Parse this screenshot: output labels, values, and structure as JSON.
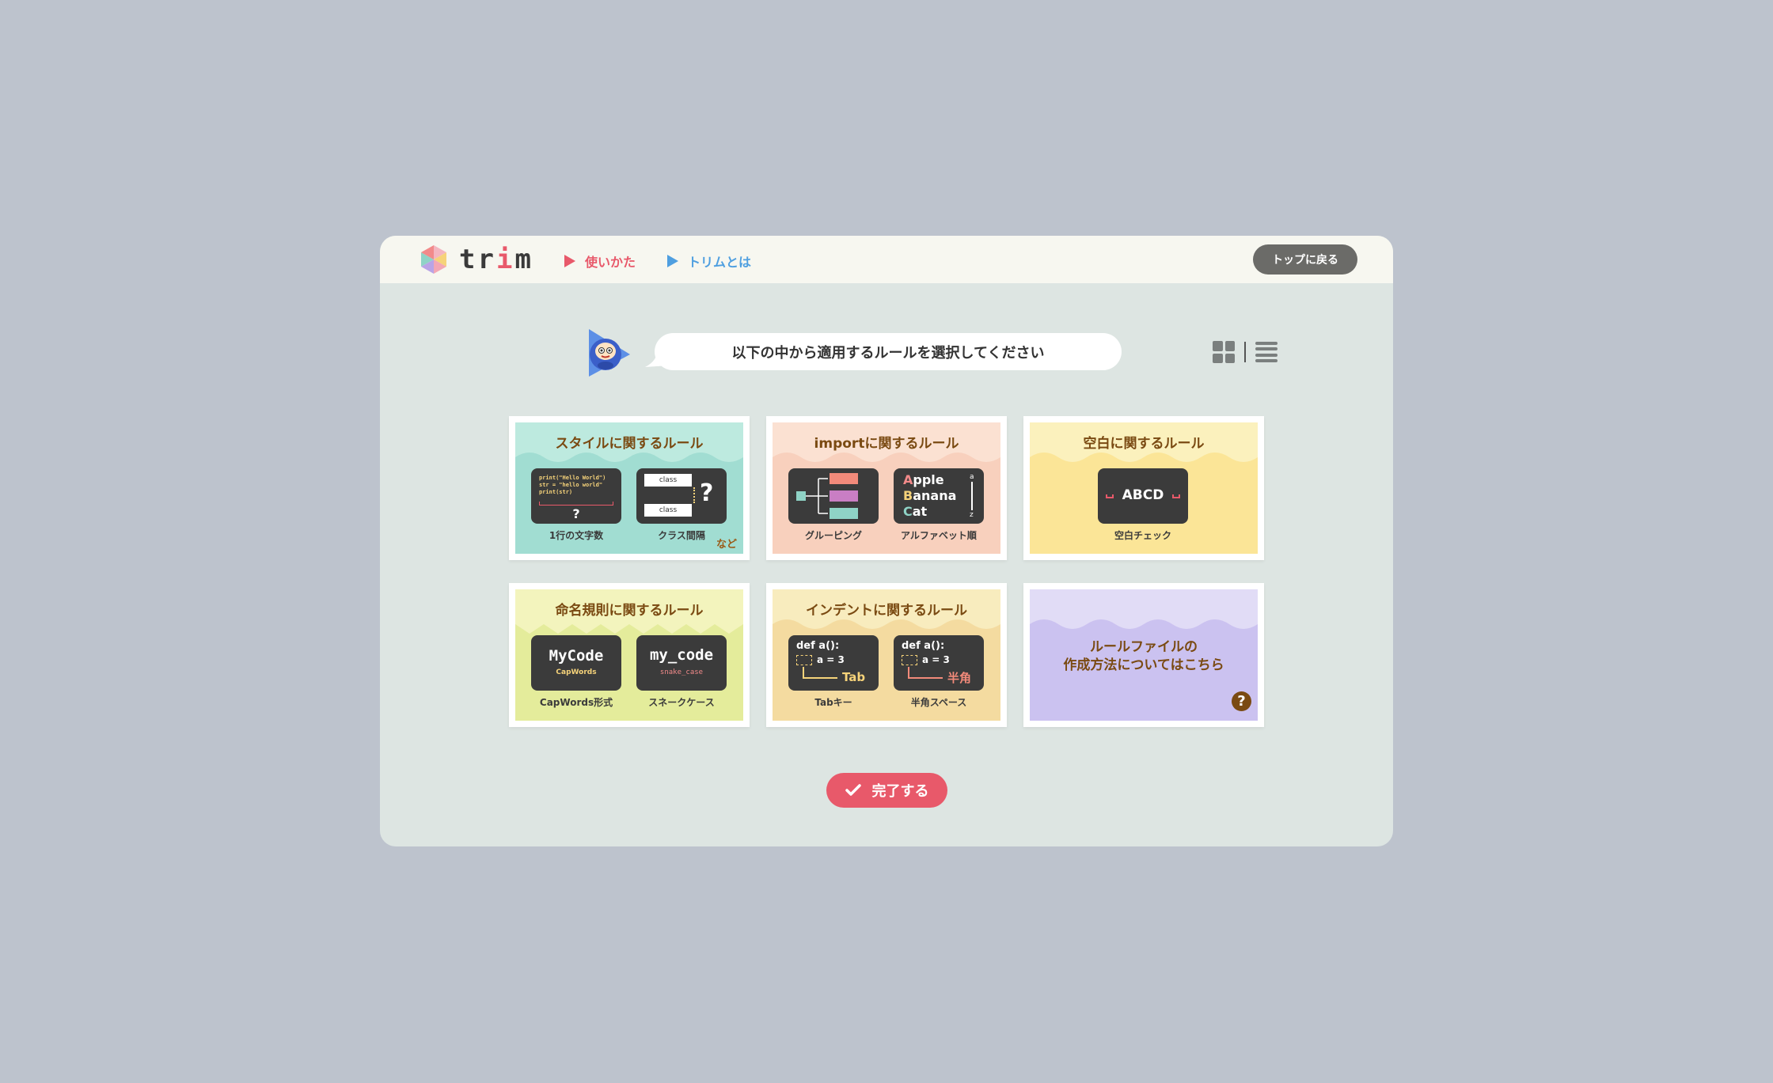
{
  "header": {
    "logo_text": "trim",
    "nav": [
      {
        "label": "使いかた",
        "color": "#e8596a"
      },
      {
        "label": "トリムとは",
        "color": "#4f9fe0"
      }
    ],
    "top_button": "トップに戻る"
  },
  "prompt": {
    "message": "以下の中から適用するルールを選択してください"
  },
  "cards": {
    "style": {
      "title": "スタイルに関するルール",
      "code_lines": [
        "print(\"Hello World\")",
        "str = \"hello world\"",
        "print(str)"
      ],
      "question": "?",
      "class_label": "class",
      "labels": [
        "1行の文字数",
        "クラス間隔"
      ],
      "more": "など",
      "colors": {
        "bg": "#a1ddd2",
        "wave": "#bdeadf"
      }
    },
    "import": {
      "title": "importに関するルール",
      "alpha": [
        {
          "first": "A",
          "rest": "pple"
        },
        {
          "first": "B",
          "rest": "anana"
        },
        {
          "first": "C",
          "rest": "at"
        }
      ],
      "range": [
        "a",
        "z"
      ],
      "labels": [
        "グルーピング",
        "アルファベット順"
      ],
      "colors": {
        "bg": "#f8d0bd",
        "wave": "#fbe1d2"
      }
    },
    "whitespace": {
      "title": "空白に関するルール",
      "sample": "ABCD",
      "labels": [
        "空白チェック"
      ],
      "colors": {
        "bg": "#fbe597",
        "wave": "#fbf1bd"
      }
    },
    "naming": {
      "title": "命名規則に関するルール",
      "items": [
        {
          "main": "MyCode",
          "sub": "CapWords"
        },
        {
          "main": "my_code",
          "sub": "snake_case"
        }
      ],
      "labels": [
        "CapWords形式",
        "スネークケース"
      ],
      "colors": {
        "bg": "#e4ec9b",
        "wave": "#f3f4bd"
      }
    },
    "indent": {
      "title": "インデントに関するルール",
      "code_head": "def a():",
      "code_body": "a = 3",
      "arrows": [
        "Tab",
        "半角"
      ],
      "labels": [
        "Tabキー",
        "半角スペース"
      ],
      "colors": {
        "bg": "#f4dba0",
        "wave": "#f8ecbe"
      }
    },
    "rulefile": {
      "title_line1": "ルールファイルの",
      "title_line2": "作成方法についてはこちら",
      "help": "?",
      "colors": {
        "bg": "#cbc2f0",
        "wave": "#e1dcf6"
      }
    }
  },
  "done_button": "完了する"
}
